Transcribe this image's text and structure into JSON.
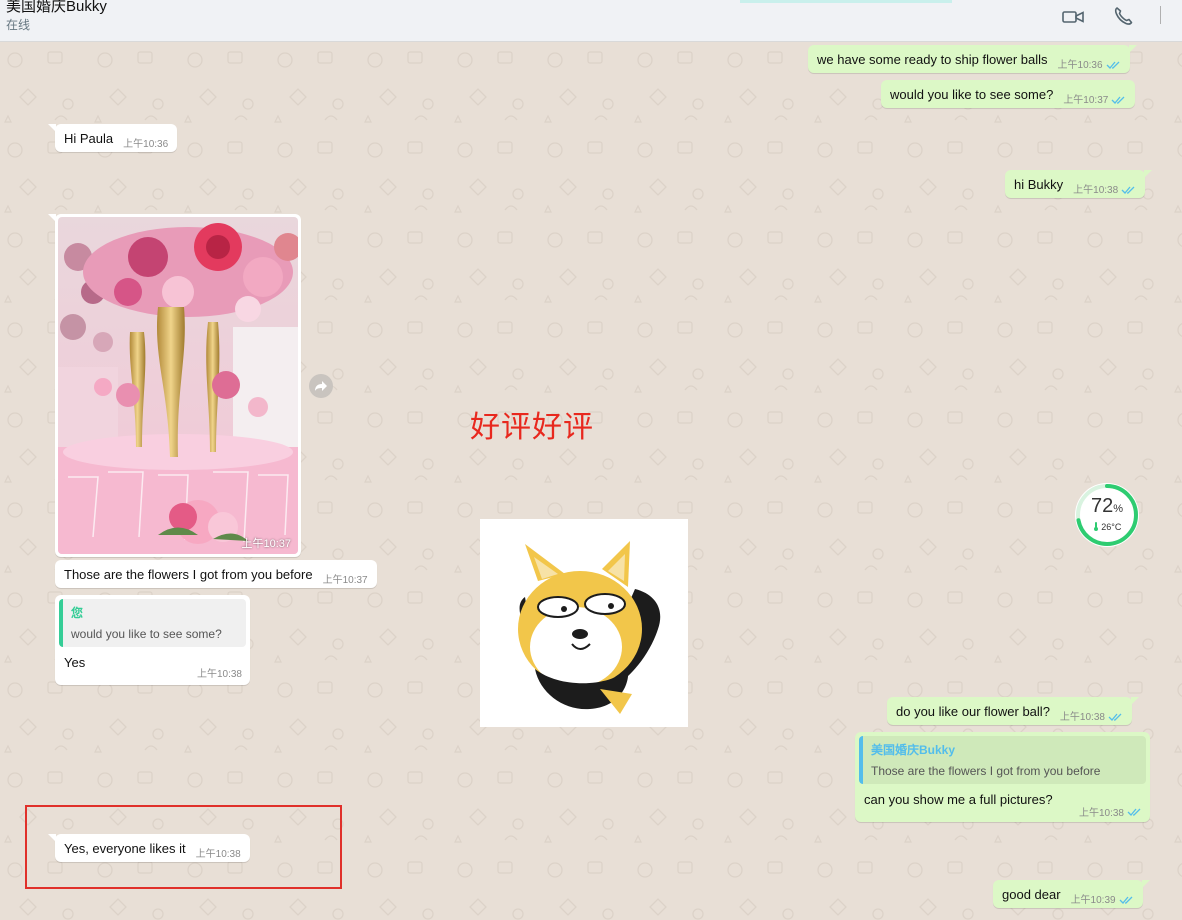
{
  "header": {
    "contact_name": "美国婚庆Bukky",
    "status": "在线",
    "icons": [
      "video-call-icon",
      "phone-call-icon"
    ]
  },
  "messages": {
    "m1": {
      "text": "we have some ready to ship flower balls",
      "time": "上午10:36"
    },
    "m2": {
      "text": "would you like to see some?",
      "time": "上午10:37"
    },
    "m3": {
      "text": "Hi Paula",
      "time": "上午10:36"
    },
    "m4": {
      "text": "hi Bukky",
      "time": "上午10:38"
    },
    "photo": {
      "time": "上午10:37"
    },
    "m5": {
      "text": "Those are the flowers I got from you before",
      "time": "上午10:37"
    },
    "m6": {
      "quote_name": "您",
      "quote_text": "would you like to see some?",
      "text": "Yes",
      "time": "上午10:38"
    },
    "m7": {
      "text": "do you like our flower ball?",
      "time": "上午10:38"
    },
    "m8": {
      "quote_name": "美国婚庆Bukky",
      "quote_text": "Those are the flowers I got from you before",
      "text": "can you show me a full pictures?",
      "time": "上午10:38"
    },
    "m9": {
      "text": "Yes, everyone likes it",
      "time": "上午10:38"
    },
    "m10": {
      "text": "good dear",
      "time": "上午10:39"
    }
  },
  "overlay": {
    "text": "好评好评"
  },
  "gauge": {
    "percent_value": "72",
    "percent_sign": "%",
    "temperature": "26°C",
    "level": 0.72
  },
  "colors": {
    "accent_red": "#e8281e",
    "out_bubble": "#dcf8c6",
    "tick_blue": "#53bdeb"
  }
}
